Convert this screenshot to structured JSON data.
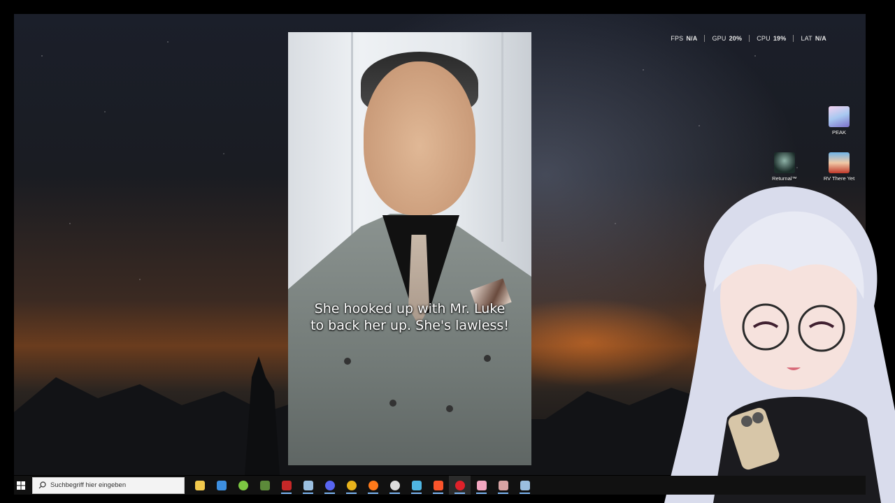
{
  "perf_overlay": {
    "fps": {
      "label": "FPS",
      "value": "N/A"
    },
    "gpu": {
      "label": "GPU",
      "value": "20%"
    },
    "cpu": {
      "label": "CPU",
      "value": "19%"
    },
    "lat": {
      "label": "LAT",
      "value": "N/A"
    }
  },
  "video": {
    "subtitle": "She hooked up with Mr. Luke to back her up. She's lawless!"
  },
  "desktop_icons": [
    {
      "label": "PEAK",
      "icon": "peak-game-icon"
    },
    {
      "label": "Returnal™",
      "icon": "returnal-game-icon"
    },
    {
      "label": "RV There Yet",
      "icon": "rv-there-yet-game-icon"
    }
  ],
  "taskbar": {
    "search_placeholder": "Suchbegriff hier eingeben",
    "pinned": [
      {
        "name": "file-explorer",
        "color": "#f2c94c"
      },
      {
        "name": "microsoft-store",
        "color": "#3d8fe0"
      },
      {
        "name": "android-app",
        "color": "#7cc742"
      },
      {
        "name": "minecraft",
        "color": "#5c8a3a"
      },
      {
        "name": "app-red-badge",
        "color": "#c62828"
      },
      {
        "name": "steam",
        "color": "#9bbfe0"
      },
      {
        "name": "discord",
        "color": "#5865f2"
      },
      {
        "name": "chrome",
        "color": "#e8b31b"
      },
      {
        "name": "firefox",
        "color": "#ff7a1a"
      },
      {
        "name": "obs-studio",
        "color": "#dddddd"
      },
      {
        "name": "app-blue",
        "color": "#4fb6e3"
      },
      {
        "name": "brave",
        "color": "#fb542b"
      },
      {
        "name": "opera",
        "color": "#e0212a"
      },
      {
        "name": "app-pink",
        "color": "#f3a6c0"
      },
      {
        "name": "app-white-red",
        "color": "#d9a4a4"
      },
      {
        "name": "steam-2",
        "color": "#9bbfe0"
      }
    ]
  }
}
